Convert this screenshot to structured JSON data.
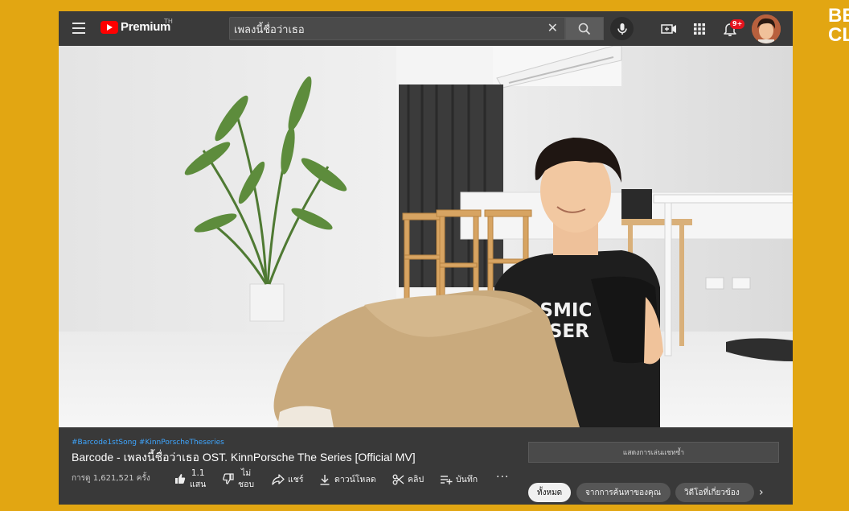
{
  "corner_brand": "BE\nCL",
  "topbar": {
    "logo_text": "Premium",
    "region": "TH",
    "search_value": "เพลงนี้ชื่อว่าเธอ",
    "notification_count": "9+"
  },
  "video": {
    "shirt_text_line1": "COSMIC",
    "shirt_text_line2": "CRUISER"
  },
  "info": {
    "hashtags": [
      "#Barcode1stSong",
      "#KinnPorscheTheseries"
    ],
    "title": "Barcode - เพลงนี้ชื่อว่าเธอ OST. KinnPorsche The Series [Official MV]",
    "views": "การดู 1,621,521 ครั้ง",
    "like": {
      "line1": "1.1",
      "line2": "แสน"
    },
    "dislike": {
      "line1": "ไม่",
      "line2": "ชอบ"
    },
    "share": "แชร์",
    "download": "ดาวน์โหลด",
    "clip": "คลิป",
    "save": "บันทึก",
    "more": "···"
  },
  "sidebar": {
    "chat_replay": "แสดงการเล่นแชทซ้ำ",
    "chips": [
      "ทั้งหมด",
      "จากการค้นหาของคุณ",
      "วิดีโอที่เกี่ยวข้อง"
    ]
  },
  "colors": {
    "accent": "#ff0000",
    "background": "#e2a612",
    "link": "#3ea6ff"
  }
}
